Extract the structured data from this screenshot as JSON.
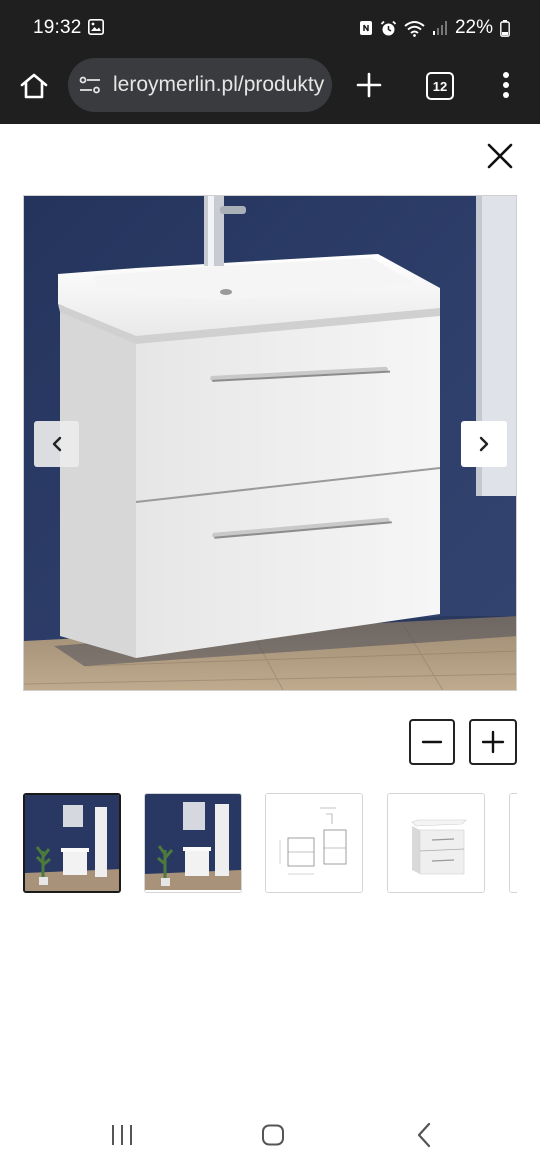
{
  "status_bar": {
    "time": "19:32",
    "battery": "22%",
    "icons": [
      "gallery-icon",
      "nfc-icon",
      "alarm-icon",
      "wifi-icon",
      "signal-icon",
      "battery-icon"
    ]
  },
  "browser": {
    "url": "leroymerlin.pl/produkty",
    "tab_count": "12",
    "icons": [
      "home-icon",
      "site-settings-icon",
      "plus-icon",
      "more-vert-icon"
    ]
  },
  "gallery": {
    "icons": [
      "close-icon",
      "chevron-left-icon",
      "chevron-right-icon",
      "minus-icon",
      "plus-icon"
    ],
    "thumbnail_count": 5,
    "active_thumbnail": 0
  },
  "colors": {
    "system_bar": "#1f1f1f",
    "address_bar": "#3a3b3e",
    "wall_navy": "#2b3a63",
    "cabinet_white": "#f1f1f1",
    "floor_wood": "#b39e83"
  },
  "nav_bar": {
    "icons": [
      "recents-icon",
      "home-pill-icon",
      "back-icon"
    ]
  }
}
